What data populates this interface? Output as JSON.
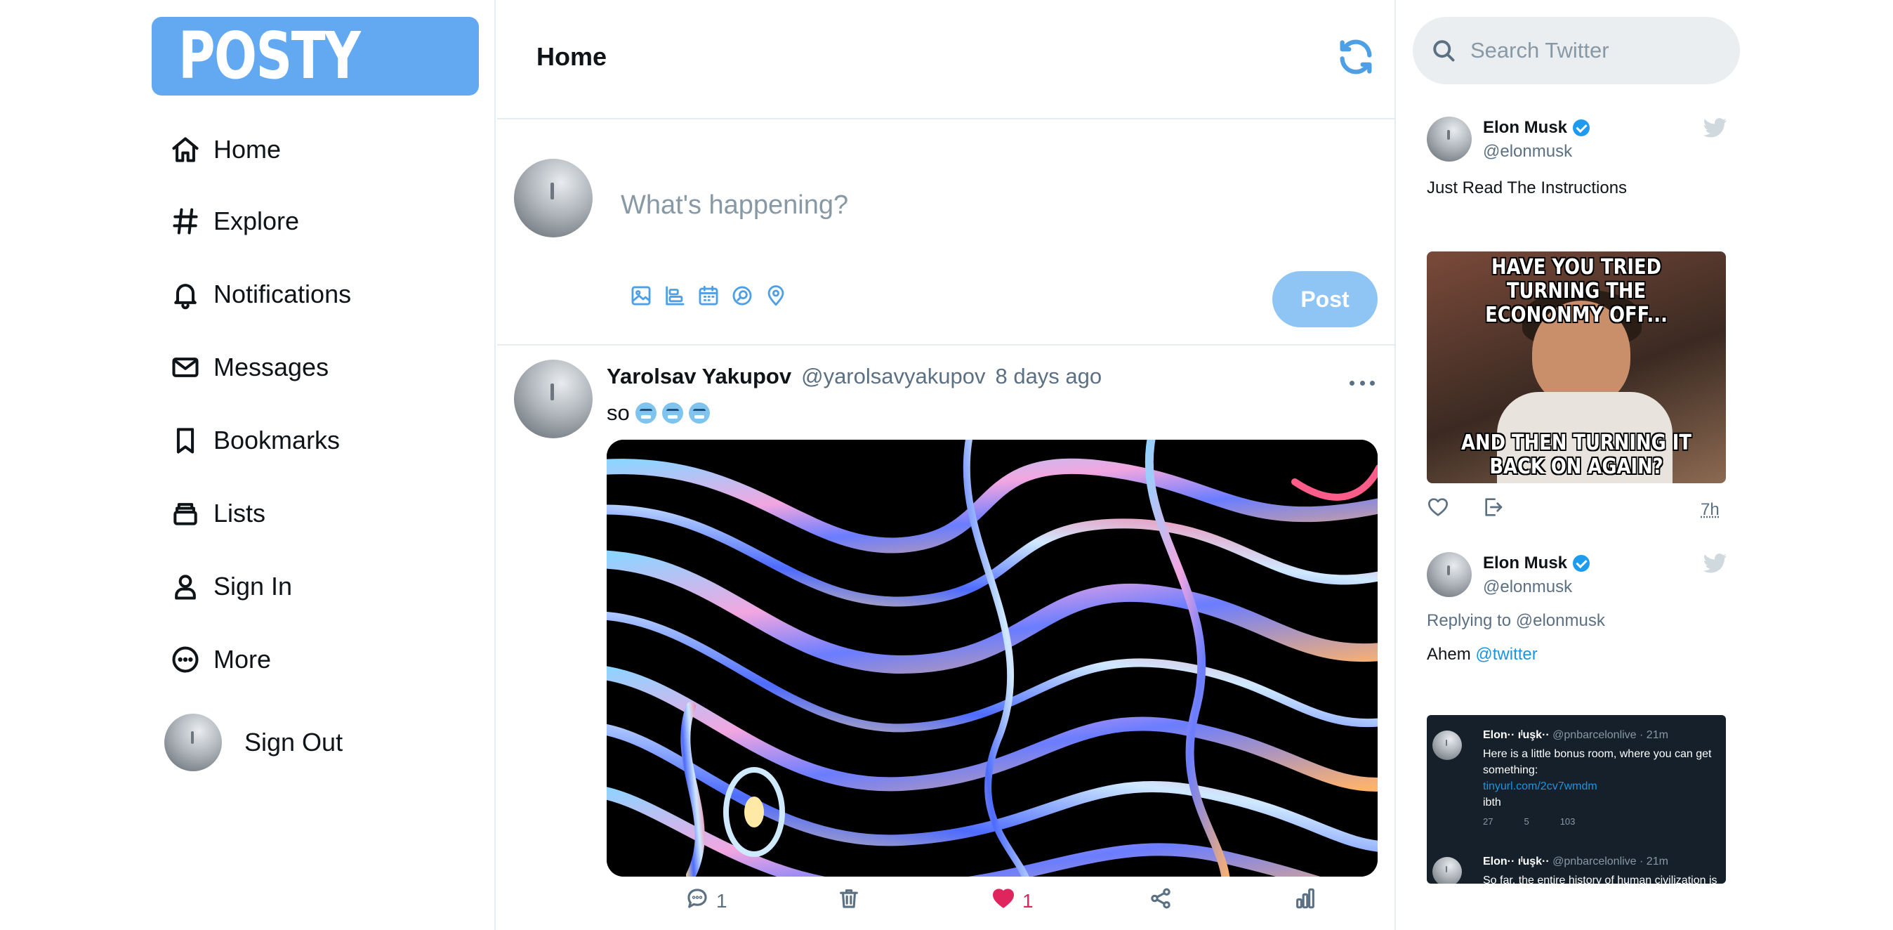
{
  "app": {
    "logo": "POSTY"
  },
  "sidebar": {
    "items": [
      {
        "label": "Home",
        "icon": "home-icon"
      },
      {
        "label": "Explore",
        "icon": "hash-icon"
      },
      {
        "label": "Notifications",
        "icon": "bell-icon"
      },
      {
        "label": "Messages",
        "icon": "mail-icon"
      },
      {
        "label": "Bookmarks",
        "icon": "bookmark-icon"
      },
      {
        "label": "Lists",
        "icon": "lists-icon"
      },
      {
        "label": "Sign In",
        "icon": "user-icon"
      },
      {
        "label": "More",
        "icon": "more-circle-icon"
      }
    ],
    "sign_out": "Sign Out"
  },
  "header": {
    "title": "Home"
  },
  "composer": {
    "placeholder": "What's happening?",
    "post_label": "Post"
  },
  "tweet": {
    "name": "Yarolsav Yakupov",
    "handle": "@yarolsavyakupov",
    "time": "8 days ago",
    "text": "so",
    "actions": {
      "reply_count": "1",
      "like_count": "1"
    }
  },
  "search": {
    "placeholder": "Search Twitter"
  },
  "timeline": {
    "tweet1": {
      "name": "Elon Musk",
      "handle": "@elonmusk",
      "text": "Just Read The Instructions",
      "meme_top": "HAVE YOU TRIED TURNING THE ECONONMY OFF...",
      "meme_bottom": "AND THEN TURNING IT BACK ON AGAIN?",
      "time": "7h"
    },
    "tweet2": {
      "name": "Elon Musk",
      "handle": "@elonmusk",
      "replying": "Replying to @elonmusk",
      "text": "Ahem",
      "mention": "@twitter",
      "quoted": [
        {
          "name": "Elon·· ıˡuşk··",
          "handle": "@pnbarcelonlive · 21m",
          "body": "Here is a little bonus room, where you can get something:",
          "link": "tinyurl.com/2cv7wmdm",
          "tail": "ibth",
          "replies": "27",
          "retweets": "5",
          "likes": "103"
        },
        {
          "name": "Elon·· ıˡuşk··",
          "handle": "@pnbarcelonlive · 21m",
          "body": "So far, the entire history of human civilization is just a flash in the pan, but there is potential to last much longer. Humanity will persevere smat"
        }
      ]
    }
  },
  "colors": {
    "accent": "#1d9bf0",
    "logo_bg": "#62a9f2",
    "like": "#e0245e",
    "post_button": "#8ec5f5"
  }
}
